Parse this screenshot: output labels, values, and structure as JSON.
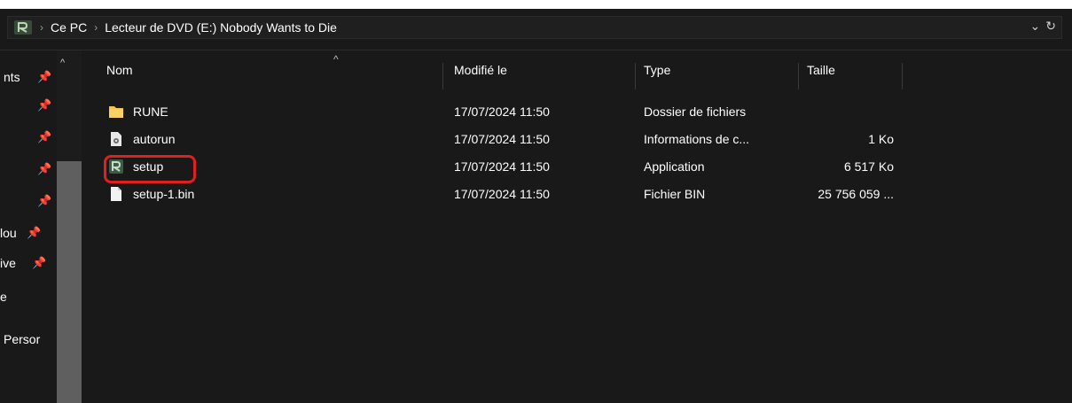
{
  "address": {
    "crumbs": [
      "Ce PC",
      "Lecteur de DVD (E:) Nobody Wants to Die"
    ],
    "drive_icon": "rune-drive-icon",
    "dropdown_icon": "chevron-down-icon",
    "refresh_icon": "refresh-icon"
  },
  "nav": {
    "items": [
      {
        "label": "nts",
        "pinned": true
      },
      {
        "label": "",
        "pinned": true
      },
      {
        "label": "",
        "pinned": true
      },
      {
        "label": "",
        "pinned": true
      },
      {
        "label": "",
        "pinned": true
      },
      {
        "label": "lou",
        "pinned": true
      },
      {
        "label": "ive",
        "pinned": true
      },
      {
        "label": "e",
        "pinned": false
      },
      {
        "label": "Persor",
        "pinned": false
      }
    ]
  },
  "columns": {
    "name": "Nom",
    "modified": "Modifié le",
    "type": "Type",
    "size": "Taille"
  },
  "files": [
    {
      "name": "RUNE",
      "modified": "17/07/2024 11:50",
      "type": "Dossier de fichiers",
      "size": "",
      "icon": "folder-icon"
    },
    {
      "name": "autorun",
      "modified": "17/07/2024 11:50",
      "type": "Informations de c...",
      "size": "1 Ko",
      "icon": "config-file-icon"
    },
    {
      "name": "setup",
      "modified": "17/07/2024 11:50",
      "type": "Application",
      "size": "6 517 Ko",
      "icon": "setup-app-icon"
    },
    {
      "name": "setup-1.bin",
      "modified": "17/07/2024 11:50",
      "type": "Fichier BIN",
      "size": "25 756 059 ...",
      "icon": "file-icon"
    }
  ],
  "colors": {
    "background": "#191919",
    "highlight": "#e0201c",
    "folder": "#f4c54a"
  }
}
